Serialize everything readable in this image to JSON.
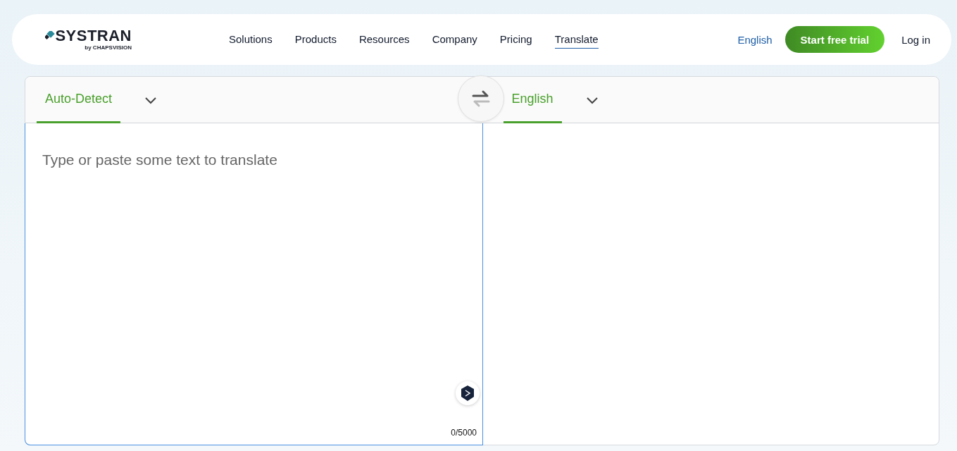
{
  "header": {
    "logo": {
      "name": "SYSTRAN",
      "byline": "by CHAPSVISION"
    },
    "nav": [
      {
        "label": "Solutions",
        "selected": false
      },
      {
        "label": "Products",
        "selected": false
      },
      {
        "label": "Resources",
        "selected": false
      },
      {
        "label": "Company",
        "selected": false
      },
      {
        "label": "Pricing",
        "selected": false
      },
      {
        "label": "Translate",
        "selected": true
      }
    ],
    "language": "English",
    "cta": "Start free trial",
    "login": "Log in"
  },
  "translator": {
    "source": {
      "language": "Auto-Detect",
      "selected": true,
      "placeholder": "Type or paste some text to translate",
      "counter": "0/5000"
    },
    "target": {
      "language": "English",
      "selected": true
    }
  }
}
